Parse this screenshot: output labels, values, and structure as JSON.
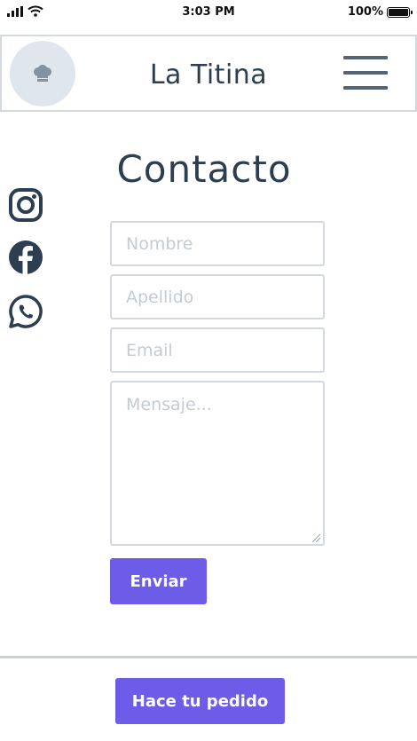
{
  "status_bar": {
    "time": "3:03 PM",
    "battery": "100%",
    "icons": [
      "signal-icon",
      "wifi-icon",
      "battery-icon"
    ]
  },
  "header": {
    "title": "La Titina",
    "logo_icon": "chef-hat-icon",
    "menu_icon": "hamburger-menu-icon"
  },
  "page": {
    "title": "Contacto"
  },
  "social": {
    "items": [
      "instagram-icon",
      "facebook-icon",
      "whatsapp-icon"
    ],
    "color": "#2c3e50"
  },
  "form": {
    "nombre": {
      "placeholder": "Nombre",
      "value": ""
    },
    "apellido": {
      "placeholder": "Apellido",
      "value": ""
    },
    "email": {
      "placeholder": "Email",
      "value": ""
    },
    "mensaje": {
      "placeholder": "Mensaje...",
      "value": ""
    },
    "submit_label": "Enviar"
  },
  "footer": {
    "order_label": "Hace tu pedido"
  },
  "colors": {
    "accent": "#6c5ce7",
    "text": "#2c3e50",
    "border": "#d3d9df",
    "placeholder": "#c5cbd3"
  }
}
